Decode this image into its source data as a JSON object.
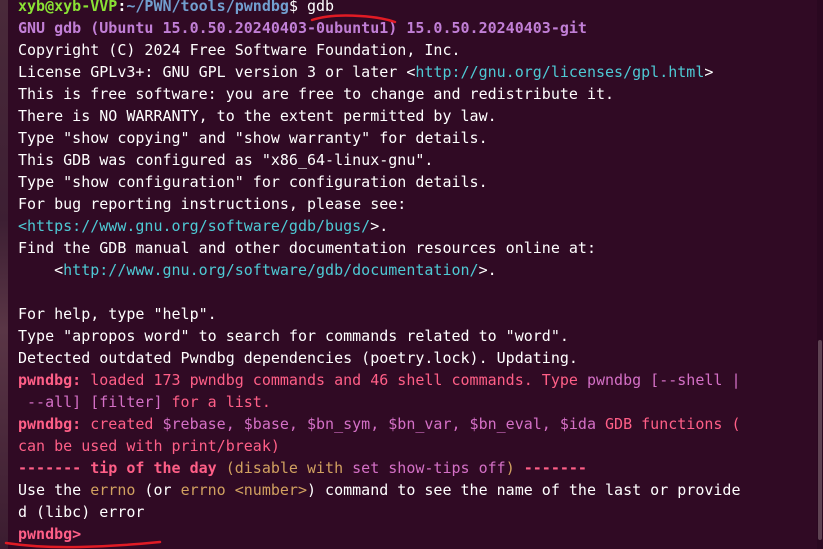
{
  "prompt": {
    "user_host": "xyb@xyb-VVP",
    "separator": ":",
    "path": "~/PWN/tools/pwndbg",
    "symbol": "$",
    "command": " gdb"
  },
  "banner": {
    "version_line": "GNU gdb (Ubuntu 15.0.50.20240403-0ubuntu1) 15.0.50.20240403-git",
    "copyright": "Copyright (C) 2024 Free Software Foundation, Inc.",
    "license_prefix": "License GPLv3+: GNU GPL version 3 or later <",
    "license_url": "http://gnu.org/licenses/gpl.html",
    "license_suffix": ">",
    "free_software": "This is free software: you are free to change and redistribute it.",
    "no_warranty": "There is NO WARRANTY, to the extent permitted by law.",
    "show_copying": "Type \"show copying\" and \"show warranty\" for details.",
    "configured": "This GDB was configured as \"x86_64-linux-gnu\".",
    "show_configuration": "Type \"show configuration\" for configuration details.",
    "bug_reporting": "For bug reporting instructions, please see:",
    "bugs_prefix": "<",
    "bugs_url": "https://www.gnu.org/software/gdb/bugs/",
    "bugs_suffix": ">.",
    "manual": "Find the GDB manual and other documentation resources online at:",
    "doc_prefix": "    <",
    "doc_url": "http://www.gnu.org/software/gdb/documentation/",
    "doc_suffix": ">.",
    "help": "For help, type \"help\".",
    "apropos": "Type \"apropos word\" to search for commands related to \"word\".",
    "outdated": "Detected outdated Pwndbg dependencies (poetry.lock). Updating."
  },
  "pwndbg": {
    "label": "pwndbg:",
    "loaded_part1": " loaded 173 pwndbg commands and 46 shell commands. Type ",
    "loaded_cmd": "pwndbg [--shell |",
    "loaded_line2_cmd": " --all] [filter]",
    "loaded_line2_rest": " for a list.",
    "created_text": " created ",
    "created_funcs": "$rebase, $base, $bn_sym, $bn_var, $bn_eval, $ida",
    "created_rest": " GDB functions (",
    "created_line2": "can be used with print/break)",
    "tip_dashes_left": "------- ",
    "tip_title": "tip of the day",
    "tip_open": " (disable with ",
    "tip_cmd": "set show-tips off",
    "tip_close": ")",
    "tip_dashes_right": " -------",
    "use_the": "Use the ",
    "errno1": "errno",
    "or_text": " (or ",
    "errno2": "errno <number>",
    "after_errno": ") command to see the name of the last or provide",
    "errno_line2": "d (libc) error",
    "final_prompt": "pwndbg>"
  },
  "colors": {
    "background": "#300a24",
    "prompt_user": "#8ae234",
    "prompt_path": "#729fcf",
    "gdb_version": "#c17fd6",
    "pwndbg_label": "#ff5f87",
    "link": "#4ec9d4",
    "annotation": "#e01b24"
  }
}
